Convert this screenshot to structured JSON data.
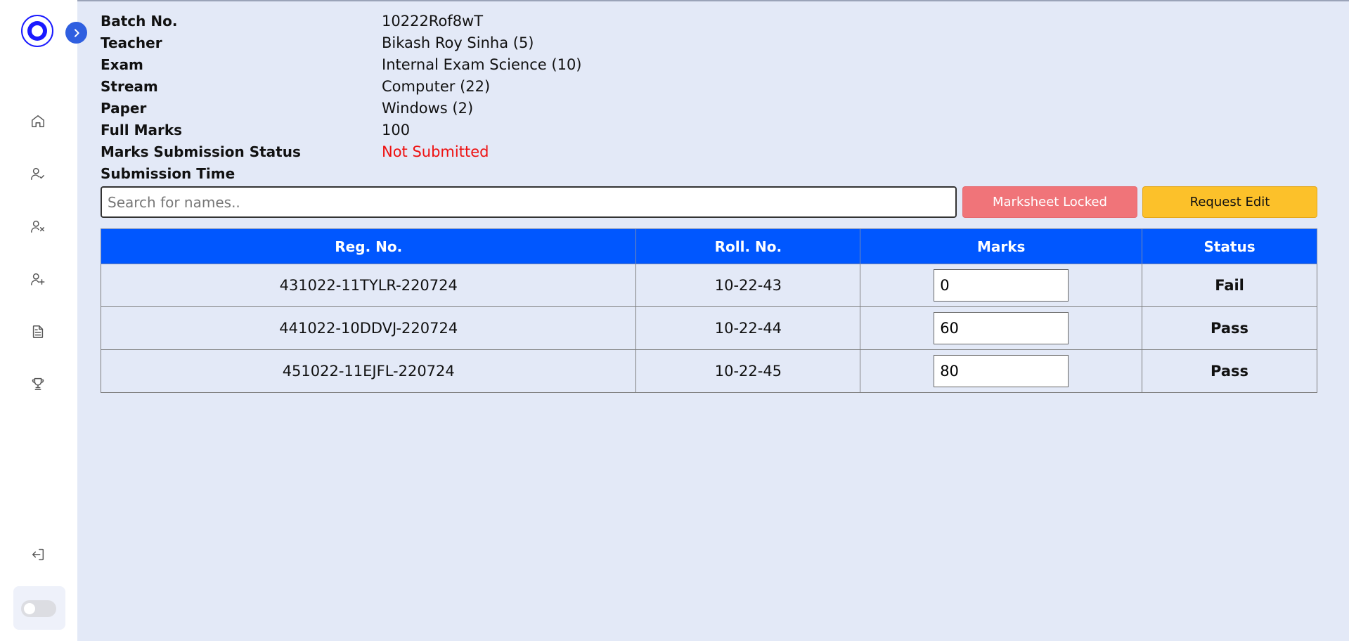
{
  "sidebar": {
    "logo": "app-logo",
    "toggle_icon": "chevron-right-icon",
    "nav_icons": [
      "home-icon",
      "user-check-icon",
      "user-x-icon",
      "user-plus-icon",
      "file-text-icon",
      "trophy-icon"
    ],
    "logout_icon": "log-out-icon",
    "theme_toggle": "off"
  },
  "info": {
    "batch_label": "Batch No.",
    "batch_value": "10222Rof8wT",
    "teacher_label": "Teacher",
    "teacher_value": "Bikash Roy Sinha (5)",
    "exam_label": "Exam",
    "exam_value": "Internal Exam Science (10)",
    "stream_label": "Stream",
    "stream_value": "Computer (22)",
    "paper_label": "Paper",
    "paper_value": "Windows (2)",
    "full_marks_label": "Full Marks",
    "full_marks_value": "100",
    "submission_status_label": "Marks Submission Status",
    "submission_status_value": "Not Submitted",
    "submission_time_label": "Submission Time",
    "submission_time_value": ""
  },
  "search": {
    "placeholder": "Search for names..",
    "value": ""
  },
  "buttons": {
    "locked": "Marksheet Locked",
    "request_edit": "Request Edit"
  },
  "table": {
    "headers": [
      "Reg. No.",
      "Roll. No.",
      "Marks",
      "Status"
    ],
    "rows": [
      {
        "reg": "431022-11TYLR-220724",
        "roll": "10-22-43",
        "marks": "0",
        "status": "Fail"
      },
      {
        "reg": "441022-10DDVJ-220724",
        "roll": "10-22-44",
        "marks": "60",
        "status": "Pass"
      },
      {
        "reg": "451022-11EJFL-220724",
        "roll": "10-22-45",
        "marks": "80",
        "status": "Pass"
      }
    ]
  },
  "colors": {
    "header": "#0057ff",
    "fail": "#ee1111",
    "pass": "#118a11",
    "locked": "#f07479",
    "request": "#fcc12a"
  }
}
